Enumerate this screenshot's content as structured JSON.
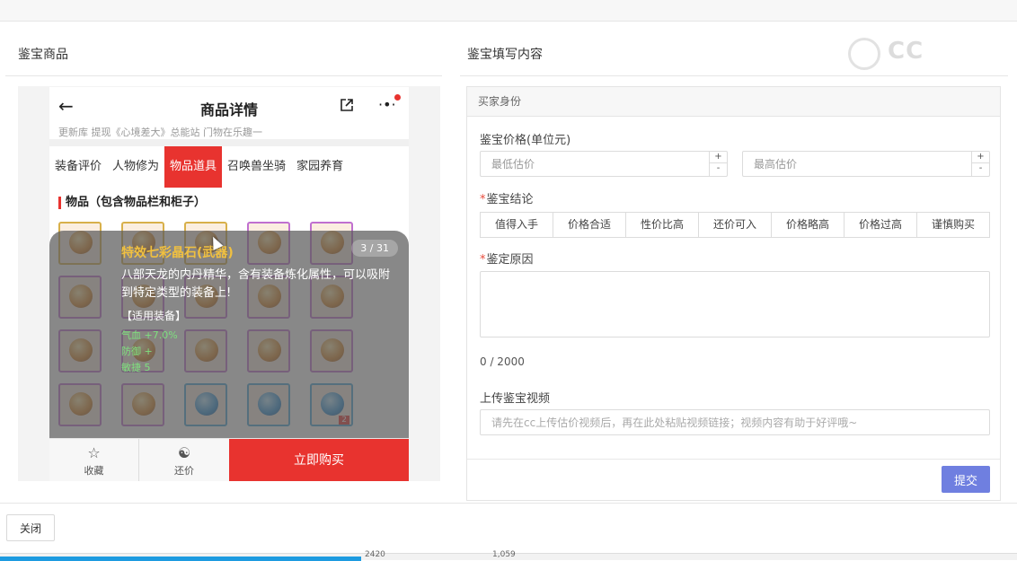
{
  "panel": {
    "left_title": "鉴宝商品",
    "right_title": "鉴宝填写内容",
    "watermark": "CC"
  },
  "phone": {
    "title": "商品详情",
    "back_icon": "arrow-left-icon",
    "share_icon": "share-icon",
    "more_icon": "more-icon",
    "strip_text": "更新库 提现《心境差大》总能站 门物在乐趣一",
    "tabs": [
      "装备评价",
      "人物修为",
      "物品道具",
      "召唤兽坐骑",
      "家园养育"
    ],
    "active_tab": "物品道具",
    "section_title": "物品（包含物品栏和柜子）",
    "overlay": {
      "item_name": "特效七彩晶石(武器)",
      "page": "3 / 31",
      "description": "八部天龙的内丹精华，含有装备炼化属性，可以吸附到特定类型的装备上!",
      "tag": "【适用装备】",
      "attrs": [
        "气血 +7.0%",
        "防御 +",
        "敏捷 5"
      ]
    },
    "grid_badge": "2",
    "bottom": {
      "favorite": "收藏",
      "bargain": "还价",
      "buy": "立即购买"
    }
  },
  "form": {
    "section_header": "买家身份",
    "price_label": "鉴宝价格(单位元)",
    "min_placeholder": "最低估价",
    "max_placeholder": "最高估价",
    "conclusion_label": "鉴宝结论",
    "conclusions": [
      "值得入手",
      "价格合适",
      "性价比高",
      "还价可入",
      "价格略高",
      "价格过高",
      "谨慎购买"
    ],
    "reason_label": "鉴定原因",
    "counter": "0 / 2000",
    "video_label": "上传鉴宝视频",
    "video_placeholder": "请先在cc上传估价视频后，再在此处粘贴视频链接；视频内容有助于好评哦~",
    "submit": "提交"
  },
  "footer": {
    "close": "关闭",
    "strip_left": "2420",
    "strip_right": "1,059"
  },
  "colors": {
    "accent_red": "#e8332f",
    "submit_blue": "#6f7fe0",
    "progress_blue": "#1e9be0"
  }
}
